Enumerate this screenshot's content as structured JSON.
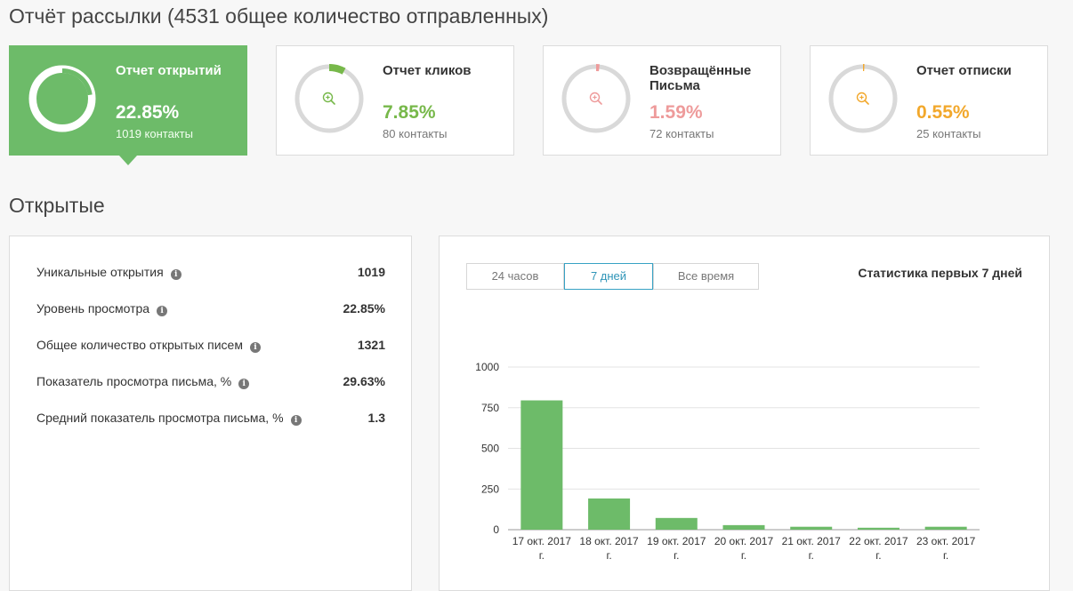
{
  "header": {
    "title": "Отчёт рассылки (4531 общее количество отправленных)"
  },
  "cards": [
    {
      "key": "opens",
      "title": "Отчет открытий",
      "percent": "22.85%",
      "contacts": "1019 контакты",
      "fraction": 0.2285,
      "color": "#ffffff",
      "active": true,
      "icon": "ring-chart-icon"
    },
    {
      "key": "clicks",
      "title": "Отчет кликов",
      "percent": "7.85%",
      "contacts": "80 контакты",
      "fraction": 0.0785,
      "color": "#77b84a",
      "active": false,
      "icon": "zoom-in-icon"
    },
    {
      "key": "bounced",
      "title": "Возвращённые Письма",
      "percent": "1.59%",
      "contacts": "72 контакты",
      "fraction": 0.0159,
      "color": "#ee9b9b",
      "active": false,
      "icon": "zoom-in-icon"
    },
    {
      "key": "unsub",
      "title": "Отчет отписки",
      "percent": "0.55%",
      "contacts": "25 контакты",
      "fraction": 0.0055,
      "color": "#f2a82c",
      "active": false,
      "icon": "zoom-in-icon"
    }
  ],
  "section": {
    "title": "Открытые"
  },
  "stats": [
    {
      "label": "Уникальные открытия",
      "value": "1019"
    },
    {
      "label": "Уровень просмотра",
      "value": "22.85%"
    },
    {
      "label": "Общее количество открытых писем",
      "value": "1321"
    },
    {
      "label": "Показатель просмотра письма, %",
      "value": "29.63%"
    },
    {
      "label": "Средний показатель просмотра письма, %",
      "value": "1.3"
    }
  ],
  "range_tabs": [
    {
      "label": "24 часов",
      "selected": false
    },
    {
      "label": "7 дней",
      "selected": true
    },
    {
      "label": "Все время",
      "selected": false
    }
  ],
  "chart_caption": "Статистика первых 7 дней",
  "chart_data": {
    "type": "bar",
    "categories": [
      [
        "17 окт. 2017",
        "г."
      ],
      [
        "18 окт. 2017",
        "г."
      ],
      [
        "19 окт. 2017",
        "г."
      ],
      [
        "20 окт. 2017",
        "г."
      ],
      [
        "21 окт. 2017",
        "г."
      ],
      [
        "22 окт. 2017",
        "г."
      ],
      [
        "23 окт. 2017",
        "г."
      ]
    ],
    "values": [
      795,
      192,
      72,
      28,
      18,
      12,
      18
    ],
    "ylim": [
      0,
      1000
    ],
    "yticks": [
      0,
      250,
      500,
      750,
      1000
    ],
    "grid": true,
    "bar_color": "#6dbb69"
  }
}
